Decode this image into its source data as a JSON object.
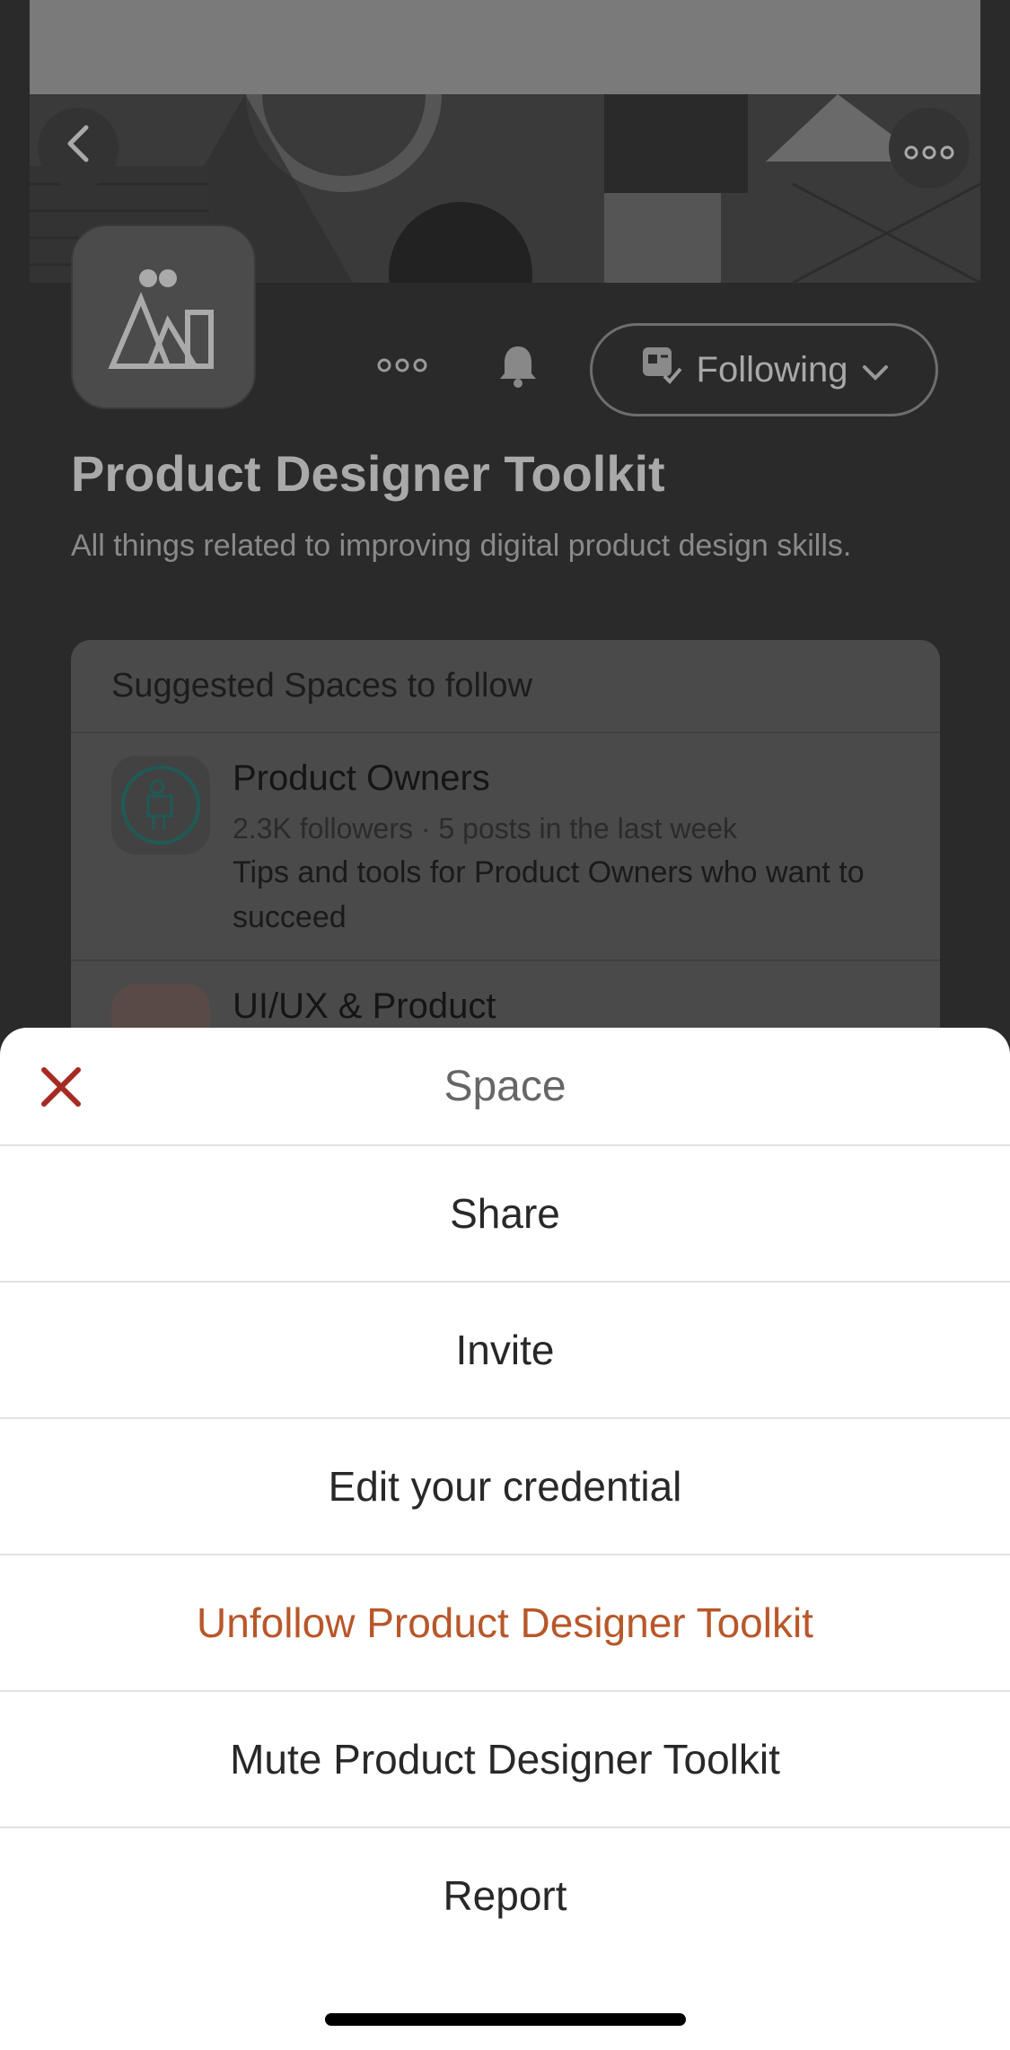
{
  "background": {
    "space": {
      "title": "Product Designer Toolkit",
      "description": "All things related to improving digital product design skills.",
      "following_label": "Following"
    },
    "suggested": {
      "heading": "Suggested Spaces to follow",
      "items": [
        {
          "name": "Product Owners",
          "meta": "2.3K followers · 5 posts in the last week",
          "description": "Tips and tools for Product Owners who want to succeed"
        },
        {
          "name": "UI/UX & Product"
        }
      ]
    }
  },
  "sheet": {
    "title": "Space",
    "close_icon": "close-icon",
    "accent_color": "#b8572a",
    "close_color": "#a62a22",
    "items": [
      {
        "label": "Share"
      },
      {
        "label": "Invite"
      },
      {
        "label": "Edit your credential"
      },
      {
        "label": "Unfollow Product Designer Toolkit",
        "style": "danger"
      },
      {
        "label": "Mute Product Designer Toolkit"
      },
      {
        "label": "Report"
      }
    ]
  }
}
